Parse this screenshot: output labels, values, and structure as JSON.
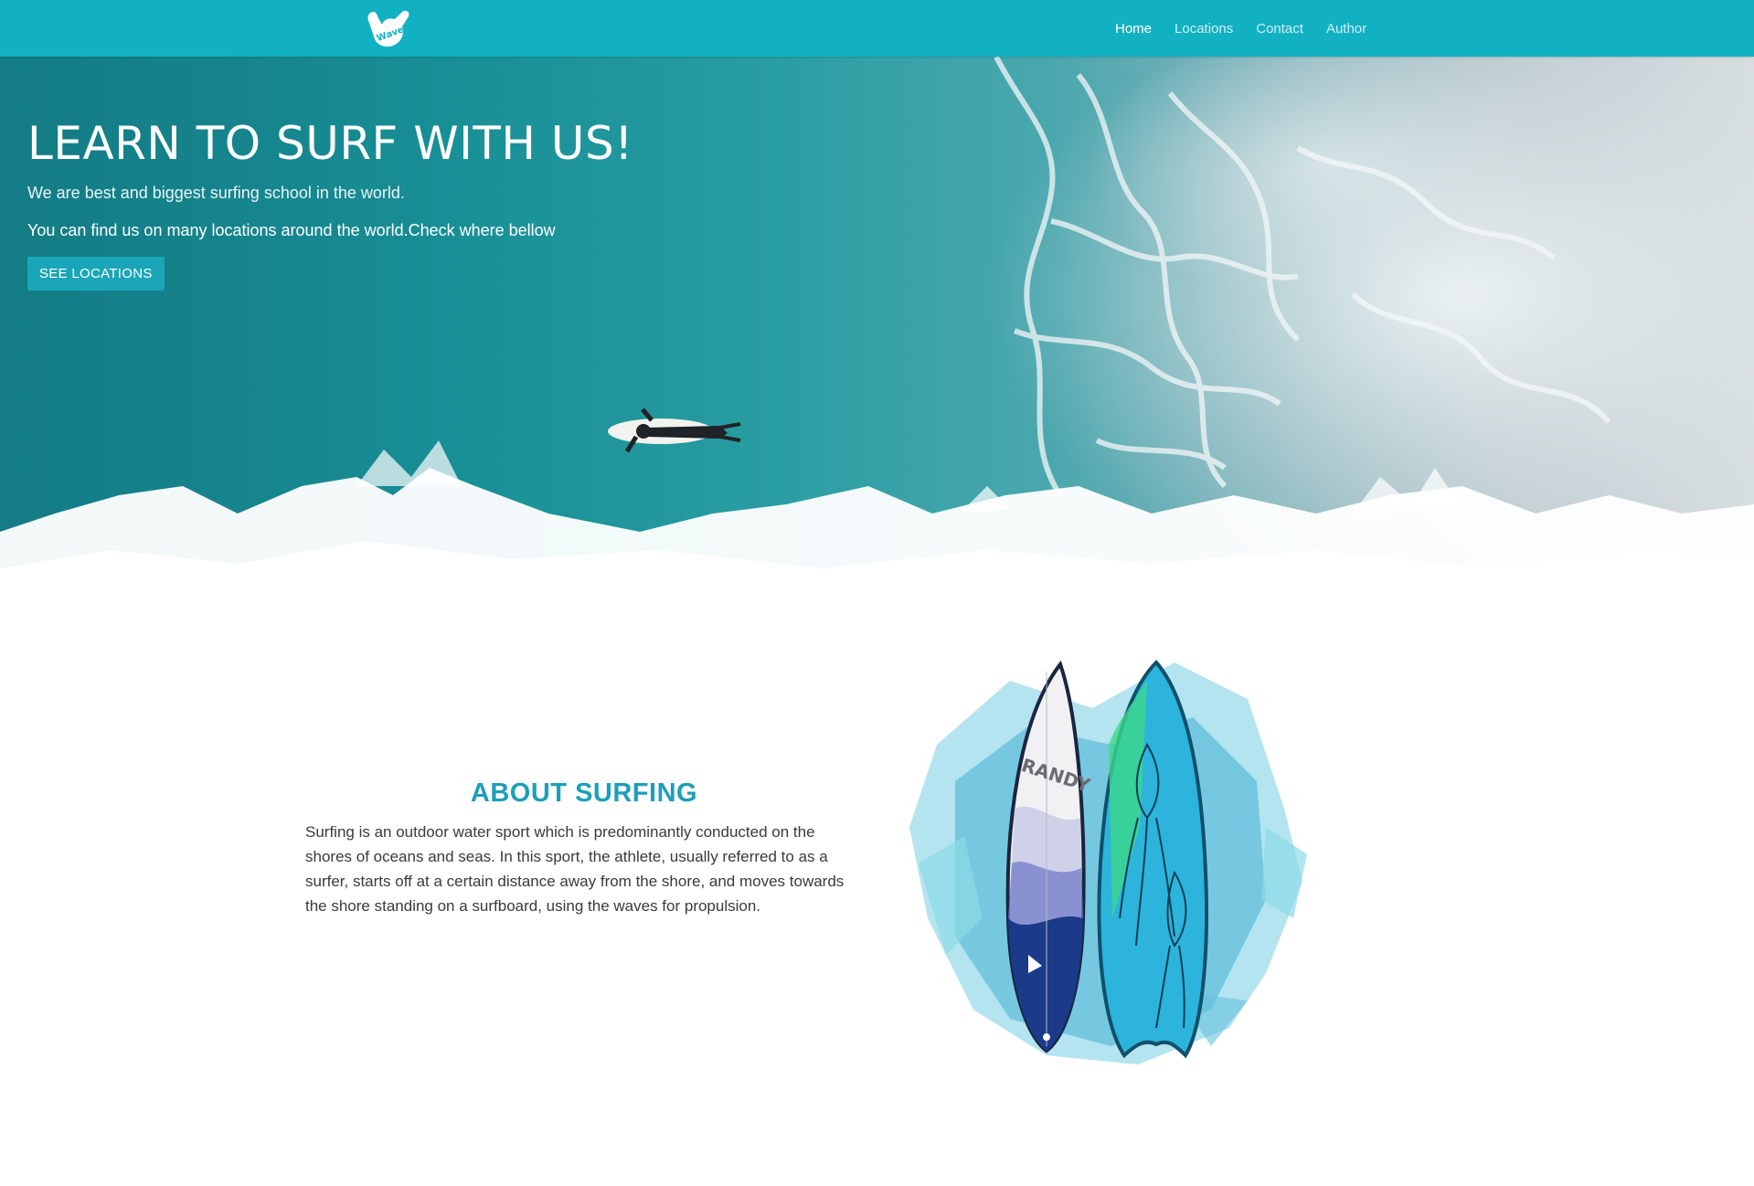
{
  "nav": {
    "logo_text": "Wave",
    "items": [
      {
        "label": "Home",
        "active": true
      },
      {
        "label": "Locations",
        "active": false
      },
      {
        "label": "Contact",
        "active": false
      },
      {
        "label": "Author",
        "active": false
      }
    ]
  },
  "hero": {
    "title": "LEARN TO SURF WITH US!",
    "subtitle": "We are best and biggest surfing school in the world.",
    "text": "You can find us on many locations around the world.Check where bellow",
    "button_label": "SEE LOCATIONS"
  },
  "about": {
    "title": "ABOUT SURFING",
    "body": "Surfing is an outdoor water sport which is predominantly conducted on the shores of oceans and seas. In this sport, the athlete, usually referred to as a surfer, starts off at a certain distance away from the shore, and moves towards the shore standing on a surfboard, using the waves for propulsion.",
    "board_text": "RANDY"
  },
  "colors": {
    "nav_bg": "#12b1c2",
    "accent": "#1c9fba",
    "button_bg": "#1aa6b8"
  },
  "icons": {
    "logo": "shaka-hand-icon"
  }
}
